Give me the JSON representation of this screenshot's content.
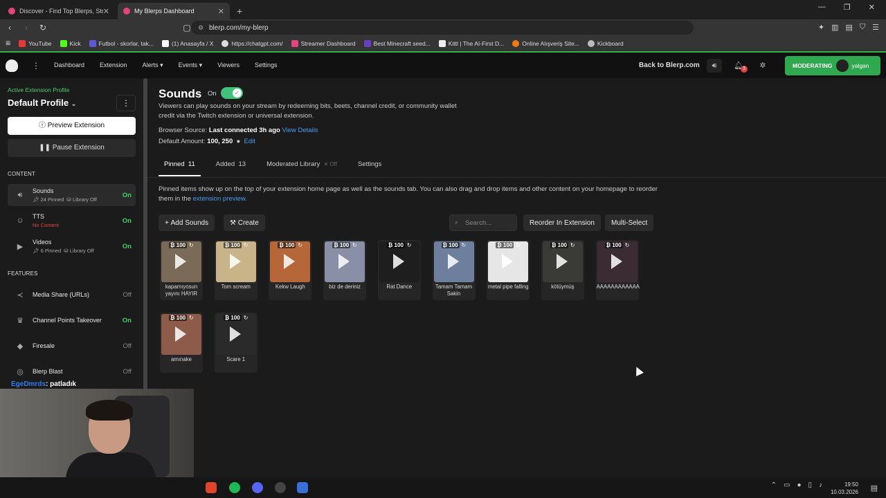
{
  "browser": {
    "tabs": [
      {
        "title": "Discover - Find Top Blerps, Streamers"
      },
      {
        "title": "My Blerps Dashboard"
      }
    ],
    "new_tab": "+",
    "url": "blerp.com/my-blerp",
    "bookmarks": [
      {
        "label": "YouTube",
        "color": "#e53935"
      },
      {
        "label": "Kick",
        "color": "#53fc18"
      },
      {
        "label": "Futbol - skorlar, tak...",
        "color": "#5b5bd6"
      },
      {
        "label": "(1) Anasayfa / X",
        "color": "#ffffff"
      },
      {
        "label": "https://chatgpt.com/",
        "color": "#dddddd"
      },
      {
        "label": "Streamer Dashboard",
        "color": "#e0457b"
      },
      {
        "label": "Best Minecraft seed...",
        "color": "#6a3fbf"
      },
      {
        "label": "Kittl | The AI-First D...",
        "color": "#eeeeee"
      },
      {
        "label": "Online Alışveriş Site...",
        "color": "#f07a1a"
      },
      {
        "label": "Kickboard",
        "color": "#bbbbbb"
      }
    ]
  },
  "topnav": {
    "links": [
      "Dashboard",
      "Extension",
      "Alerts ▾",
      "Events ▾",
      "Viewers",
      "Settings"
    ],
    "back": "Back to Blerp.com",
    "notif_count": "3",
    "moderating": "MODERATING",
    "user": "yalgan"
  },
  "sidebar": {
    "profile_label": "Active Extension Profile",
    "profile_name": "Default Profile",
    "preview": "Preview Extension",
    "pause": "Pause Extension",
    "content_header": "CONTENT",
    "features_header": "FEATURES",
    "content": [
      {
        "label": "Sounds",
        "sub1": "24 Pinned",
        "sub2": "Library Off",
        "status": "On"
      },
      {
        "label": "TTS",
        "sub1": "No Content",
        "sub2": "",
        "status": "On"
      },
      {
        "label": "Videos",
        "sub1": "6 Pinned",
        "sub2": "Library Off",
        "status": "On"
      }
    ],
    "features": [
      {
        "label": "Media Share (URLs)",
        "status": "Off"
      },
      {
        "label": "Channel Points Takeover",
        "status": "On"
      },
      {
        "label": "Firesale",
        "status": "Off"
      },
      {
        "label": "Blerp Blast",
        "status": "Off"
      }
    ]
  },
  "chat": {
    "name": "EgeDmrds",
    "msg": ": patladık"
  },
  "main": {
    "title": "Sounds",
    "toggle_label": "On",
    "description": "Viewers can play sounds on your stream by redeeming bits, beets, channel credit, or community wallet credit via the Twitch extension or universal extension.",
    "browser_source_label": "Browser Source:",
    "browser_source_value": "Last connected 3h ago",
    "view_details": "View Details",
    "default_amount_label": "Default Amount:",
    "default_amount_value": "100, 250",
    "edit": "Edit",
    "tabs": [
      {
        "label": "Pinned",
        "count": "11"
      },
      {
        "label": "Added",
        "count": "13"
      },
      {
        "label": "Moderated Library",
        "count": "Off"
      },
      {
        "label": "Settings",
        "count": ""
      }
    ],
    "info_text": "Pinned items show up on the top of your extension home page as well as the sounds tab. You can also drag and drop items and other content on your homepage to reorder them in the",
    "info_link": "extension preview.",
    "add_sounds": "Add Sounds",
    "create": "Create",
    "search_placeholder": "Search...",
    "reorder": "Reorder In Extension",
    "multi_select": "Multi-Select",
    "sounds": [
      {
        "price": "100",
        "name": "kapamıyosun yayını HAYIR",
        "color": "#7a6a58"
      },
      {
        "price": "100",
        "name": "Tom scream",
        "color": "#c9b48a"
      },
      {
        "price": "100",
        "name": "Kekw Laugh",
        "color": "#b5673a"
      },
      {
        "price": "100",
        "name": "biz de deriniz",
        "color": "#8a8fa8"
      },
      {
        "price": "100",
        "name": "Rat Dance",
        "color": "#1e1e1e"
      },
      {
        "price": "100",
        "name": "Tamam Tamam Sakin",
        "color": "#6d7f9c"
      },
      {
        "price": "100",
        "name": "metal pipe falling",
        "color": "#e6e6e6"
      },
      {
        "price": "100",
        "name": "kötüymüş",
        "color": "#3a3a36"
      },
      {
        "price": "100",
        "name": "AAAAAAAAAAAA",
        "color": "#3b2b33"
      },
      {
        "price": "100",
        "name": "amınake",
        "color": "#8e5a4a"
      },
      {
        "price": "100",
        "name": "Scare 1",
        "color": "#2a2a2a"
      }
    ]
  },
  "taskbar": {
    "time": "19:50",
    "date": "10.03.2026"
  }
}
